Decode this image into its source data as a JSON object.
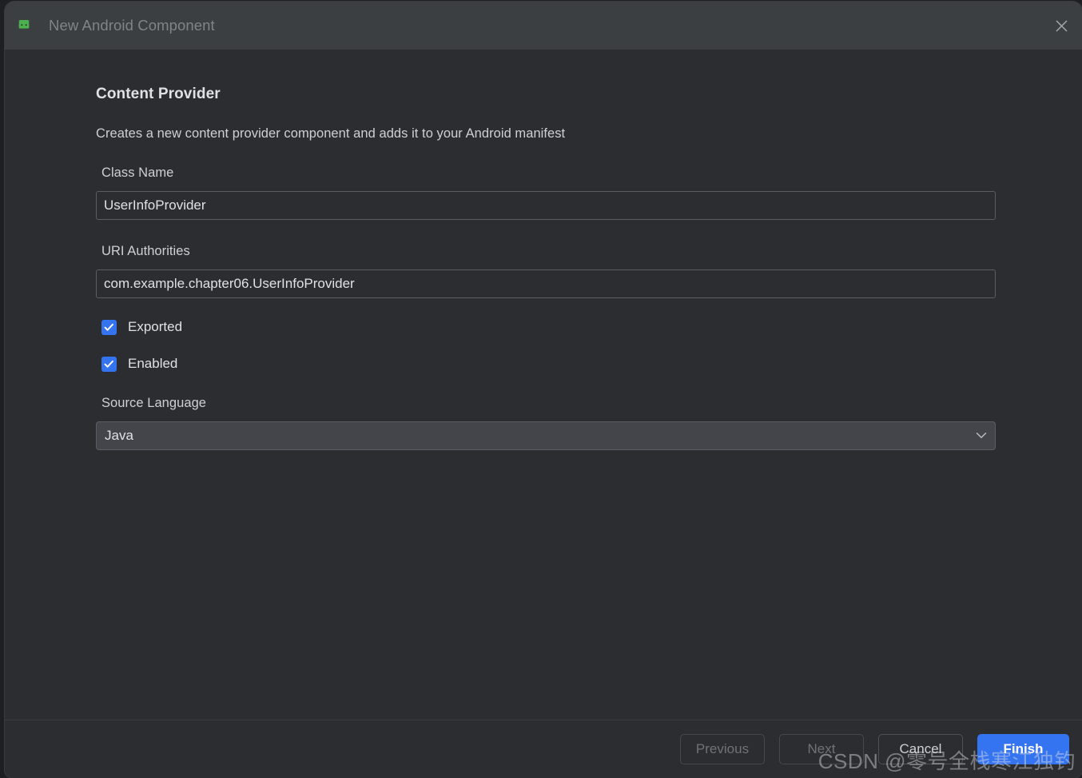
{
  "window": {
    "title": "New Android Component",
    "icon": "android-icon",
    "close_icon": "close-icon"
  },
  "page": {
    "heading": "Content Provider",
    "description": "Creates a new content provider component and adds it to your Android manifest"
  },
  "fields": {
    "class_name": {
      "label": "Class Name",
      "value": "UserInfoProvider"
    },
    "uri_authorities": {
      "label": "URI Authorities",
      "value": "com.example.chapter06.UserInfoProvider"
    },
    "exported": {
      "label": "Exported",
      "checked": true
    },
    "enabled": {
      "label": "Enabled",
      "checked": true
    },
    "source_language": {
      "label": "Source Language",
      "value": "Java",
      "chevron_icon": "chevron-down-icon"
    }
  },
  "footer": {
    "previous": "Previous",
    "next": "Next",
    "cancel": "Cancel",
    "finish": "Finish"
  },
  "watermark": "CSDN @零号全栈寒江独钓",
  "colors": {
    "accent": "#3574F0",
    "titlebar": "#3C3F41",
    "body": "#2B2D30",
    "android_green": "#3DDC84"
  }
}
